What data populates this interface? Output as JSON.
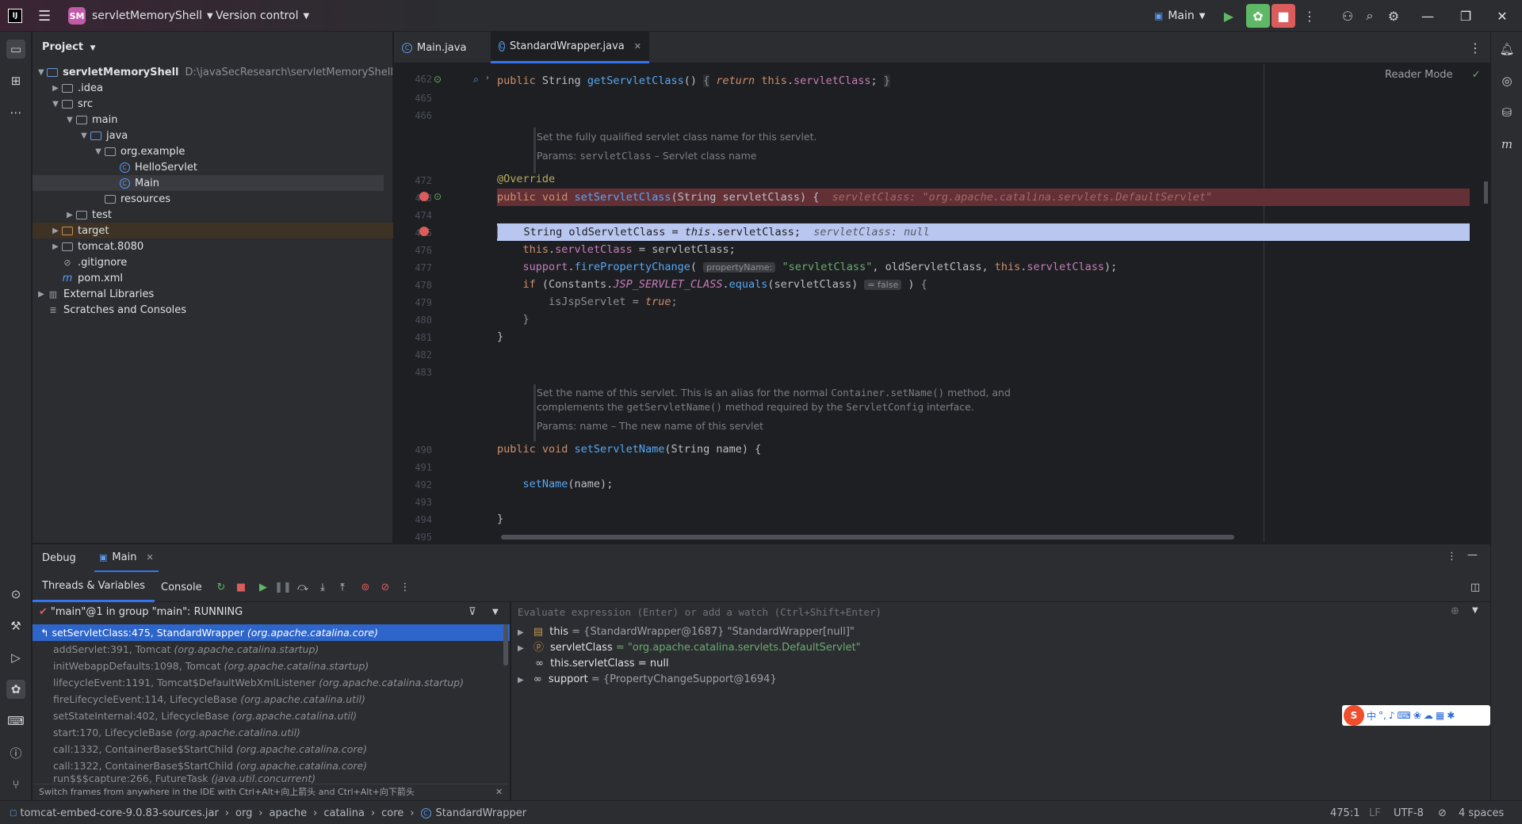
{
  "titlebar": {
    "project_badge": "SM",
    "project_name": "servletMemoryShell",
    "vcs": "Version control",
    "run_config": "Main"
  },
  "project_panel": {
    "title": "Project",
    "root_name": "servletMemoryShell",
    "root_path": "D:\\javaSecResearch\\servletMemoryShell",
    "items": [
      {
        "label": ".idea"
      },
      {
        "label": "src"
      },
      {
        "label": "main"
      },
      {
        "label": "java"
      },
      {
        "label": "org.example"
      },
      {
        "label": "HelloServlet"
      },
      {
        "label": "Main"
      },
      {
        "label": "resources"
      },
      {
        "label": "test"
      },
      {
        "label": "target"
      },
      {
        "label": "tomcat.8080"
      },
      {
        "label": ".gitignore"
      },
      {
        "label": "pom.xml"
      },
      {
        "label": "External Libraries"
      },
      {
        "label": "Scratches and Consoles"
      }
    ]
  },
  "tabs": [
    {
      "label": "Main.java"
    },
    {
      "label": "StandardWrapper.java"
    }
  ],
  "editor": {
    "reader_mode": "Reader Mode",
    "line_numbers": [
      "462",
      "465",
      "466",
      "472",
      "473",
      "474",
      "475",
      "476",
      "477",
      "478",
      "479",
      "480",
      "481",
      "482",
      "483",
      "490",
      "491",
      "492",
      "493",
      "494",
      "495"
    ],
    "doc1_line1": "Set the fully qualified servlet class name for this servlet.",
    "doc1_params": "Params:",
    "doc1_param_name": "servletClass",
    "doc1_param_desc": "– Servlet class name",
    "doc2_line1a": "Set the name of this servlet. This is an alias for the normal",
    "doc2_line1b": "Container.setName()",
    "doc2_line1c": "method, and",
    "doc2_line2a": "complements the",
    "doc2_line2b": "getServletName()",
    "doc2_line2c": "method required by the",
    "doc2_line2d": "ServletConfig",
    "doc2_line2e": "interface.",
    "doc2_params": "Params:",
    "doc2_param_name": "name",
    "doc2_param_desc": "– The new name of this servlet",
    "hint_property_name": "propertyName:",
    "hint_false": "= false",
    "inline_servlet_class": "servletClass: \"org.apache.catalina.servlets.DefaultServlet\"",
    "inline_null": "servletClass: null"
  },
  "debug": {
    "title": "Debug",
    "session": "Main",
    "tab_threads": "Threads & Variables",
    "tab_console": "Console",
    "thread_status": "\"main\"@1 in group \"main\": RUNNING",
    "eval_placeholder": "Evaluate expression (Enter) or add a watch (Ctrl+Shift+Enter)",
    "frames": [
      {
        "method": "setServletClass:475, StandardWrapper",
        "pkg": "(org.apache.catalina.core)"
      },
      {
        "method": "addServlet:391, Tomcat",
        "pkg": "(org.apache.catalina.startup)"
      },
      {
        "method": "initWebappDefaults:1098, Tomcat",
        "pkg": "(org.apache.catalina.startup)"
      },
      {
        "method": "lifecycleEvent:1191, Tomcat$DefaultWebXmlListener",
        "pkg": "(org.apache.catalina.startup)"
      },
      {
        "method": "fireLifecycleEvent:114, LifecycleBase",
        "pkg": "(org.apache.catalina.util)"
      },
      {
        "method": "setStateInternal:402, LifecycleBase",
        "pkg": "(org.apache.catalina.util)"
      },
      {
        "method": "start:170, LifecycleBase",
        "pkg": "(org.apache.catalina.util)"
      },
      {
        "method": "call:1332, ContainerBase$StartChild",
        "pkg": "(org.apache.catalina.core)"
      },
      {
        "method": "call:1322, ContainerBase$StartChild",
        "pkg": "(org.apache.catalina.core)"
      },
      {
        "method": "run$$$capture:266, FutureTask",
        "pkg": "(java.util.concurrent)"
      }
    ],
    "frames_hint": "Switch frames from anywhere in the IDE with Ctrl+Alt+向上箭头 and Ctrl+Alt+向下箭头",
    "variables": [
      {
        "name": "this",
        "value": "= {StandardWrapper@1687} \"StandardWrapper[null]\""
      },
      {
        "name": "servletClass",
        "value": "= \"org.apache.catalina.servlets.DefaultServlet\""
      },
      {
        "name": "this.servletClass",
        "value": "= null"
      },
      {
        "name": "support",
        "value": "= {PropertyChangeSupport@1694}"
      }
    ]
  },
  "statusbar": {
    "crumbs": [
      "tomcat-embed-core-9.0.83-sources.jar",
      "org",
      "apache",
      "catalina",
      "core",
      "StandardWrapper"
    ],
    "position": "475:1",
    "line_sep": "LF",
    "encoding": "UTF-8",
    "indent": "4 spaces"
  },
  "ime": {
    "chinese": "中"
  },
  "colors": {
    "accent": "#3574f0",
    "breakpoint": "#db5c5c",
    "run_green": "#5fb865",
    "stop_red": "#db5c5c"
  }
}
